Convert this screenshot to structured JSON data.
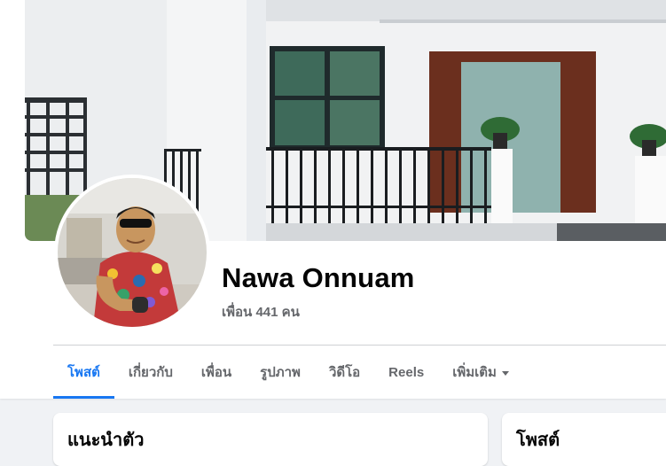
{
  "profile": {
    "name": "Nawa Onnuam",
    "friends_text": "เพื่อน 441 คน"
  },
  "tabs": [
    {
      "label": "โพสต์",
      "active": true
    },
    {
      "label": "เกี่ยวกับ",
      "active": false
    },
    {
      "label": "เพื่อน",
      "active": false
    },
    {
      "label": "รูปภาพ",
      "active": false
    },
    {
      "label": "วิดีโอ",
      "active": false
    },
    {
      "label": "Reels",
      "active": false
    },
    {
      "label": "เพิ่มเติม",
      "active": false
    }
  ],
  "cards": {
    "intro_title": "แนะนำตัว",
    "posts_title": "โพสต์"
  },
  "colors": {
    "accent": "#1877f2",
    "secondary_text": "#65676b",
    "background": "#f0f2f5"
  }
}
